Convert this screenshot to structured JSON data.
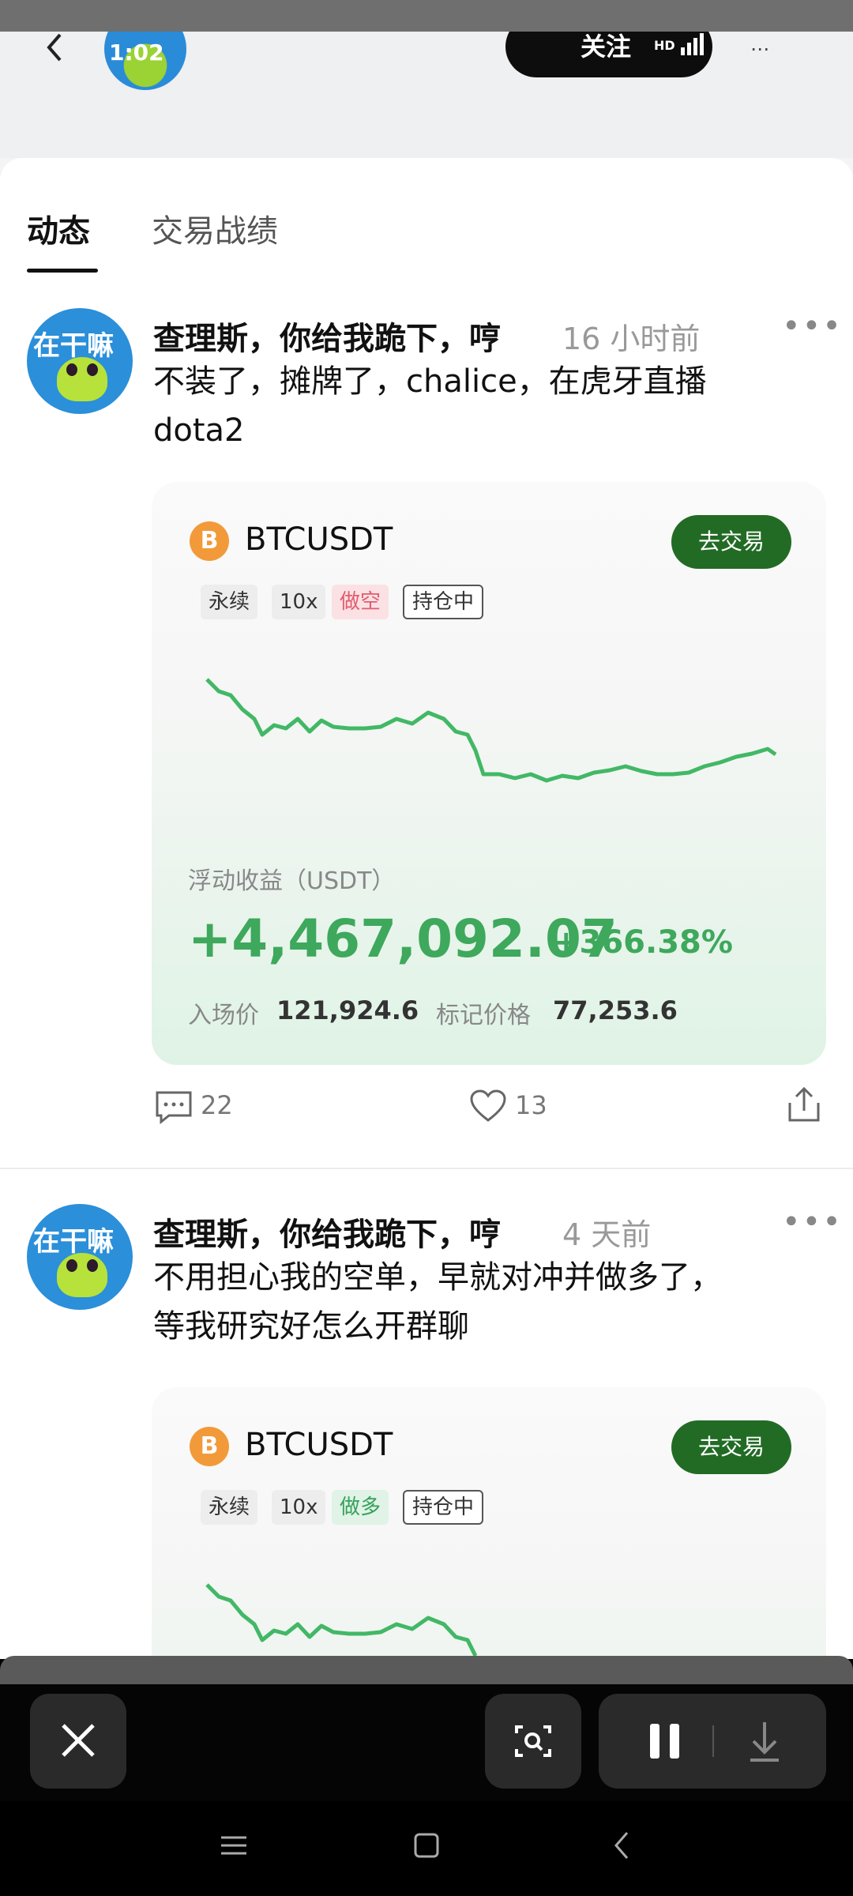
{
  "status": {
    "time": "1:02",
    "network": "HD"
  },
  "header": {
    "follow_label": "关注"
  },
  "tabs": [
    {
      "label": "动态",
      "active": true
    },
    {
      "label": "交易战绩",
      "active": false
    }
  ],
  "posts": [
    {
      "author": "查理斯，你给我跪下，哼",
      "avatar_text": "在干嘛",
      "time": "16 小时前",
      "more": "•••",
      "text": "不装了，摊牌了，chalice，在虎牙直播 dota2",
      "card": {
        "coin_icon": "B",
        "pair": "BTCUSDT",
        "trade_button": "去交易",
        "tags": [
          "永续",
          "10x",
          "做空",
          "持仓中"
        ],
        "pnl_label": "浮动收益（USDT）",
        "pnl_value": "+4,467,092.07",
        "pnl_pct": "+366.38%",
        "entry_label": "入场价",
        "entry_price": "121,924.6",
        "mark_label": "标记价格",
        "mark_price": "77,253.6"
      },
      "comments": "22",
      "likes": "13"
    },
    {
      "author": "查理斯，你给我跪下，哼",
      "avatar_text": "在干嘛",
      "time": "4 天前",
      "more": "•••",
      "text_line1": "不用担心我的空单，早就对冲并做多了，",
      "text_line2": "等我研究好怎么开群聊",
      "card": {
        "coin_icon": "B",
        "pair": "BTCUSDT",
        "trade_button": "去交易",
        "tags": [
          "永续",
          "10x",
          "做多",
          "持仓中"
        ]
      }
    }
  ],
  "colors": {
    "accent_green": "#3ea85c",
    "button_green": "#226b25",
    "short_red": "#e35c6f"
  },
  "icons": [
    "back-icon",
    "signal-icon",
    "bitcoin-icon",
    "comment-icon",
    "heart-icon",
    "share-icon",
    "close-icon",
    "screenshot-icon",
    "pause-icon",
    "download-icon",
    "menu-icon",
    "home-icon"
  ]
}
